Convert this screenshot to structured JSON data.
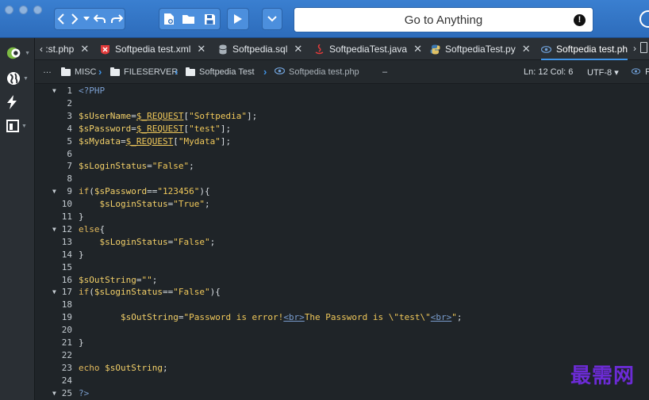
{
  "toolbar": {
    "goto_label": "Go to Anything",
    "alert_icon_glyph": "!"
  },
  "tabs": [
    {
      "label": "‹ :st.php",
      "icon": "php-file-icon"
    },
    {
      "label": "Softpedia test.xml",
      "icon": "xml-file-icon"
    },
    {
      "label": "Softpedia.sql",
      "icon": "sql-file-icon"
    },
    {
      "label": "SoftpediaTest.java",
      "icon": "java-file-icon"
    },
    {
      "label": "SoftpediaTest.py",
      "icon": "python-file-icon"
    },
    {
      "label": "Softpedia test.ph",
      "icon": "php-eye-icon",
      "active": true
    }
  ],
  "tab_close_glyph": "✕",
  "breadcrumb": {
    "ellipsis": "…",
    "items": [
      "MISC",
      "FILESERVER",
      "Softpedia Test",
      "Softpedia test.php"
    ],
    "trailing": "–"
  },
  "status": {
    "position": "Ln: 12 Col: 6",
    "encoding": "UTF-8 ▾",
    "extra": "P"
  },
  "code_lines": [
    {
      "n": "1",
      "fold": "▼",
      "text": "<?PHP"
    },
    {
      "n": "2",
      "fold": "",
      "text": ""
    },
    {
      "n": "3",
      "fold": "",
      "text": "$sUserName=$_REQUEST[\"Softpedia\"];"
    },
    {
      "n": "4",
      "fold": "",
      "text": "$sPassword=$_REQUEST[\"test\"];"
    },
    {
      "n": "5",
      "fold": "",
      "text": "$sMydata=$_REQUEST[\"Mydata\"];"
    },
    {
      "n": "6",
      "fold": "",
      "text": ""
    },
    {
      "n": "7",
      "fold": "",
      "text": "$sLoginStatus=\"False\";"
    },
    {
      "n": "8",
      "fold": "",
      "text": ""
    },
    {
      "n": "9",
      "fold": "▼",
      "text": "if($sPassword==\"123456\"){"
    },
    {
      "n": "10",
      "fold": "",
      "text": "    $sLoginStatus=\"True\";"
    },
    {
      "n": "11",
      "fold": "",
      "text": "}"
    },
    {
      "n": "12",
      "fold": "▼",
      "text": "else{"
    },
    {
      "n": "13",
      "fold": "",
      "text": "    $sLoginStatus=\"False\";"
    },
    {
      "n": "14",
      "fold": "",
      "text": "}"
    },
    {
      "n": "15",
      "fold": "",
      "text": ""
    },
    {
      "n": "16",
      "fold": "",
      "text": "$sOutString=\"\";"
    },
    {
      "n": "17",
      "fold": "▼",
      "text": "if($sLoginStatus==\"False\"){"
    },
    {
      "n": "18",
      "fold": "",
      "text": ""
    },
    {
      "n": "19",
      "fold": "",
      "text": "        $sOutString=\"Password is error!<br>The Password is \\\"test\\\"<br>\";"
    },
    {
      "n": "20",
      "fold": "",
      "text": ""
    },
    {
      "n": "21",
      "fold": "",
      "text": "}"
    },
    {
      "n": "22",
      "fold": "",
      "text": ""
    },
    {
      "n": "23",
      "fold": "",
      "text": "echo $sOutString;"
    },
    {
      "n": "24",
      "fold": "",
      "text": ""
    },
    {
      "n": "25",
      "fold": "▼",
      "text": "?>"
    }
  ],
  "watermark": "最需网",
  "colors": {
    "toolbar": "#3a7fd0",
    "editor_bg": "#1f2428",
    "keyword": "#e2b95c",
    "active_tab_underline": "#3f93e6"
  }
}
